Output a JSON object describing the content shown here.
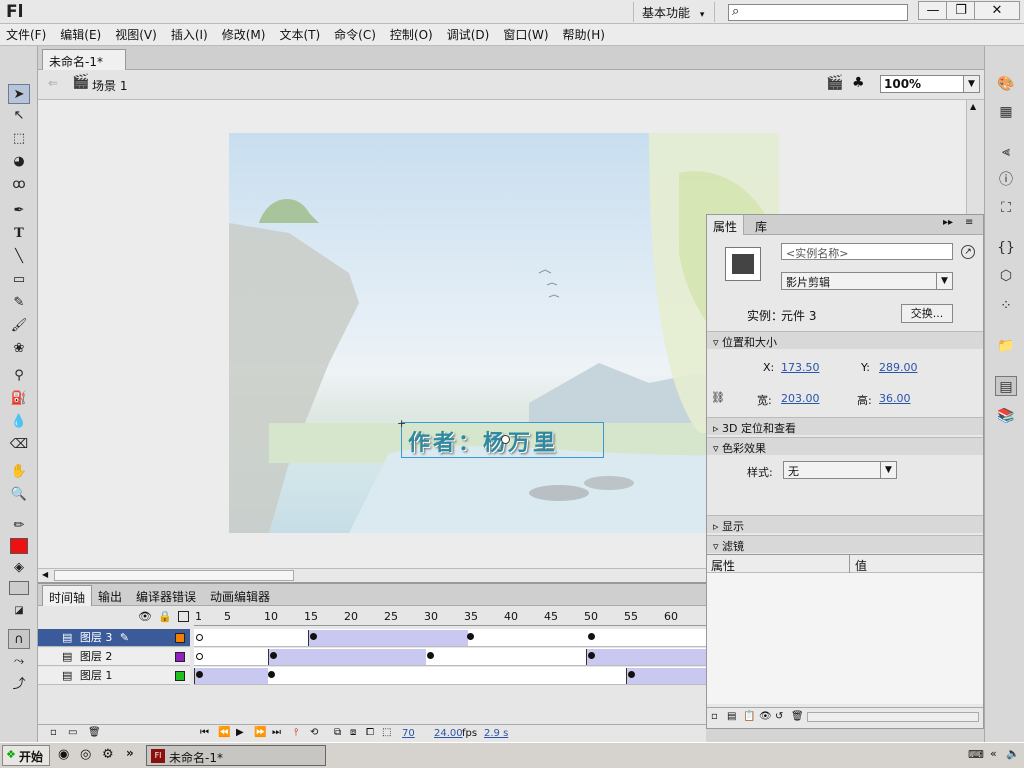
{
  "app": {
    "logo": "Fl",
    "workspace": "基本功能",
    "workspace_arrow": "▾"
  },
  "menu": [
    "文件(F)",
    "编辑(E)",
    "视图(V)",
    "插入(I)",
    "修改(M)",
    "文本(T)",
    "命令(C)",
    "控制(O)",
    "调试(D)",
    "窗口(W)",
    "帮助(H)"
  ],
  "document": {
    "tab_title": "未命名-1*",
    "scene": "场景 1",
    "zoom": "100%"
  },
  "stage": {
    "text": "作者：杨万里"
  },
  "timeline": {
    "tabs": [
      "时间轴",
      "输出",
      "编译器错误",
      "动画编辑器"
    ],
    "ruler": [
      "1",
      "5",
      "10",
      "15",
      "20",
      "25",
      "30",
      "35",
      "40",
      "45",
      "50",
      "55",
      "60"
    ],
    "layers": [
      {
        "name": "图层 3",
        "color": "#f08000"
      },
      {
        "name": "图层 2",
        "color": "#9020c0"
      },
      {
        "name": "图层 1",
        "color": "#20c020"
      }
    ],
    "status": {
      "frame": "70",
      "fps": "24.00",
      "fps_unit": "fps",
      "time": "2.9 s"
    }
  },
  "properties": {
    "tabs": [
      "属性",
      "库"
    ],
    "instance_name_placeholder": "<实例名称>",
    "type": "影片剪辑",
    "instance_label": "实例：",
    "instance_of": "元件 3",
    "swap_button": "交换...",
    "sections": {
      "pos_size": "位置和大小",
      "threed": "3D 定位和查看",
      "color": "色彩效果",
      "display": "显示",
      "filters": "滤镜"
    },
    "x_label": "X:",
    "x": "173.50",
    "y_label": "Y:",
    "y": "289.00",
    "w_label": "宽:",
    "w": "203.00",
    "h_label": "高:",
    "h": "36.00",
    "style_label": "样式:",
    "style": "无",
    "filter_cols": [
      "属性",
      "值"
    ]
  },
  "taskbar": {
    "start": "开始",
    "item": "未命名-1*"
  },
  "colors": {
    "stroke": "#222222",
    "fill": "#ee1111",
    "selection": "#3a5a9a"
  }
}
